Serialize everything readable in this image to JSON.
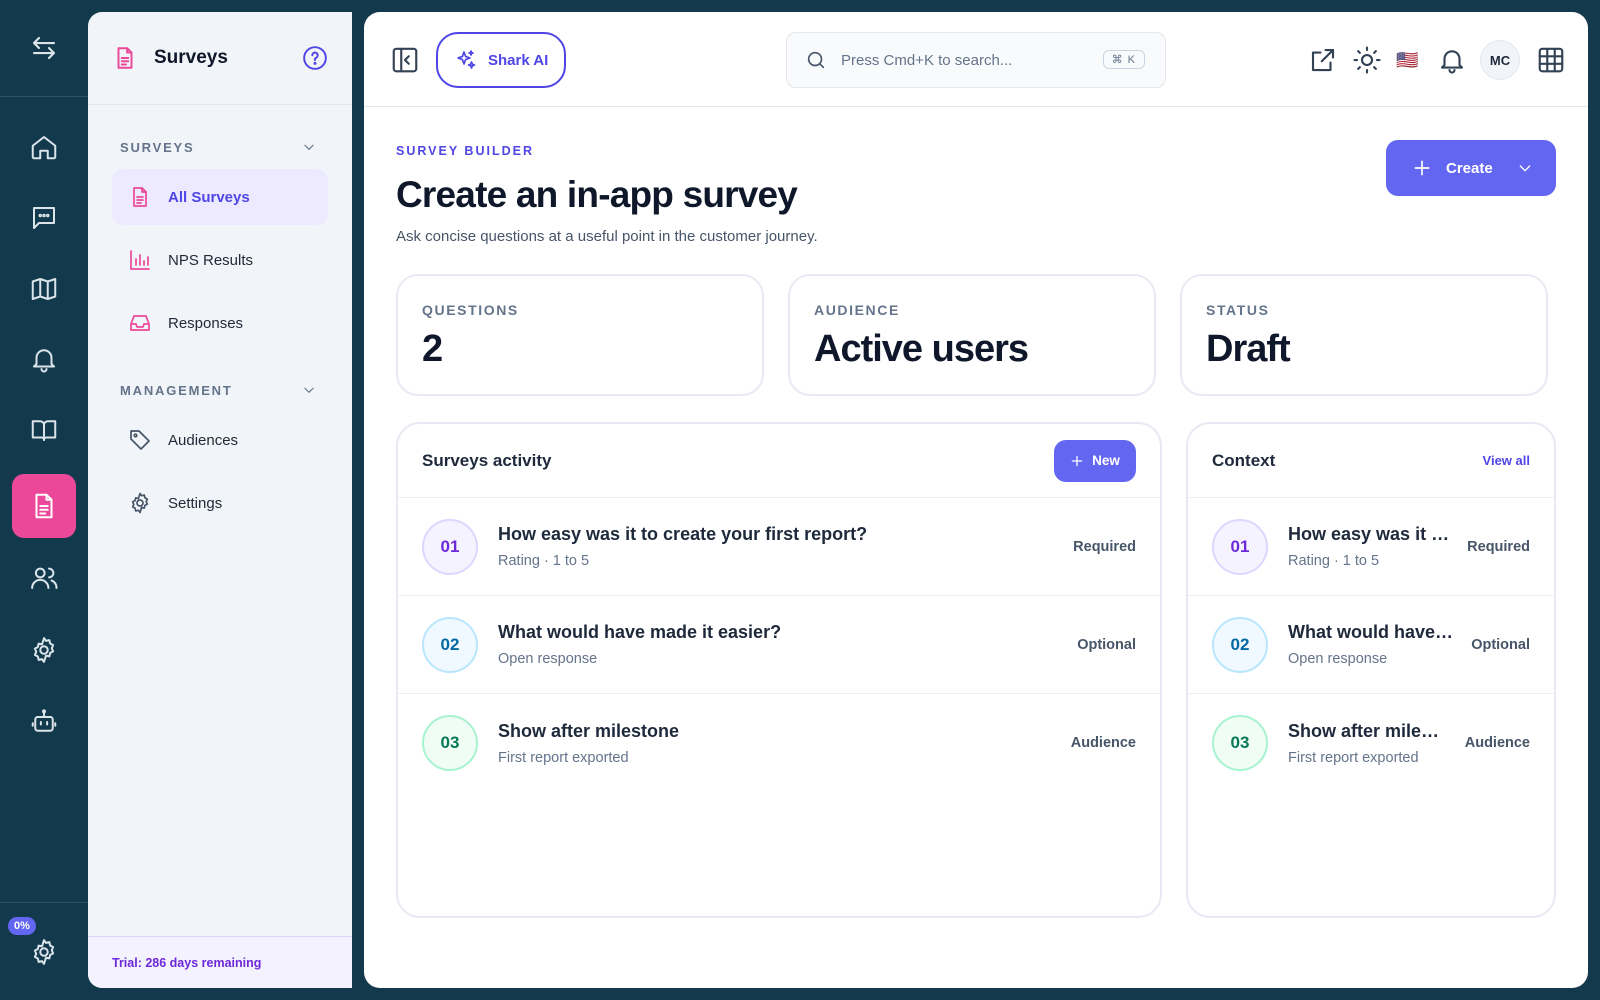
{
  "sidebar": {
    "title": "Surveys",
    "section_surveys": "SURVEYS",
    "section_management": "MANAGEMENT",
    "items": [
      {
        "label": "All Surveys"
      },
      {
        "label": "NPS Results"
      },
      {
        "label": "Responses"
      },
      {
        "label": "Audiences"
      },
      {
        "label": "Settings"
      }
    ],
    "trial": "Trial: 286 days remaining"
  },
  "rail": {
    "progress_badge": "0%"
  },
  "topbar": {
    "shark_label": "Shark AI",
    "search_placeholder": "Press Cmd+K to search...",
    "shortcut": "⌘ K",
    "flag": "🇺🇸",
    "avatar_initials": "MC"
  },
  "page": {
    "eyebrow": "SURVEY BUILDER",
    "title": "Create an in-app survey",
    "subtitle": "Ask concise questions at a useful point in the customer journey.",
    "create_label": "Create"
  },
  "stats": [
    {
      "label": "QUESTIONS",
      "value": "2"
    },
    {
      "label": "AUDIENCE",
      "value": "Active users"
    },
    {
      "label": "STATUS",
      "value": "Draft"
    }
  ],
  "activity": {
    "title": "Surveys activity",
    "new_label": "New",
    "rows": [
      {
        "num": "01",
        "question": "How easy was it to create your first report?",
        "sub": "Rating · 1 to 5",
        "tag": "Required"
      },
      {
        "num": "02",
        "question": "What would have made it easier?",
        "sub": "Open response",
        "tag": "Optional"
      },
      {
        "num": "03",
        "question": "Show after milestone",
        "sub": "First report exported",
        "tag": "Audience"
      }
    ]
  },
  "context": {
    "title": "Context",
    "view_all": "View all",
    "rows": [
      {
        "num": "01",
        "question": "How easy was it to create your first report?",
        "sub": "Rating · 1 to 5",
        "tag": "Required"
      },
      {
        "num": "02",
        "question": "What would have made it easier?",
        "sub": "Open response",
        "tag": "Optional"
      },
      {
        "num": "03",
        "question": "Show after milestone",
        "sub": "First report exported",
        "tag": "Audience"
      }
    ]
  },
  "colors": {
    "rail_bg": "#123a4c",
    "accent": "#6366f1",
    "active_rail": "#ec4899",
    "brand_purple": "#4f46e5"
  }
}
